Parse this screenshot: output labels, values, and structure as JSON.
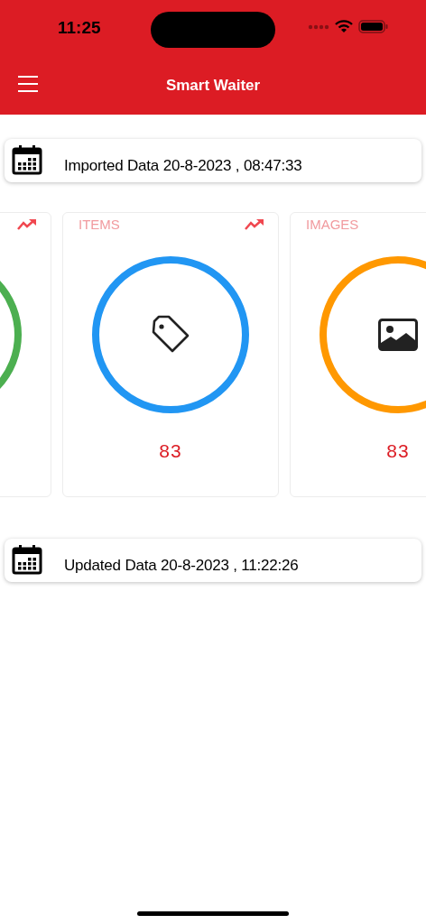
{
  "status_bar": {
    "time": "11:25"
  },
  "header": {
    "title": "Smart Waiter"
  },
  "imported": {
    "text": "Imported Data 20-8-2023 , 08:47:33"
  },
  "cards": [
    {
      "color": "#4caf50",
      "trend": true
    },
    {
      "title": "ITEMS",
      "color": "#2196f3",
      "kind": "tag",
      "value": "83",
      "trend": true
    },
    {
      "title": "IMAGES",
      "color": "#ff9800",
      "kind": "image",
      "value": "83",
      "trend": false
    }
  ],
  "updated": {
    "text": "Updated Data 20-8-2023 , 11:22:26"
  }
}
